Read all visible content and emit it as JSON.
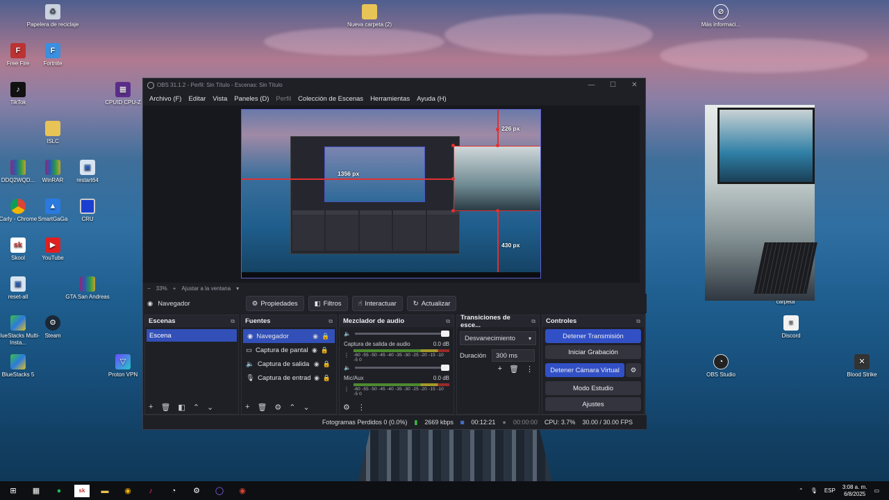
{
  "desktop": {
    "icons": [
      {
        "label": "Papelera de reciclaje",
        "icon": "recycle-bin-icon"
      },
      {
        "label": "Nueva carpeta (2)",
        "icon": "folder-icon"
      },
      {
        "label": "Más informaci...",
        "icon": "info-icon"
      },
      {
        "label": "Free Fire",
        "icon": "free-fire-icon"
      },
      {
        "label": "Fortnite",
        "icon": "fortnite-icon"
      },
      {
        "label": "TikTok",
        "icon": "tiktok-icon"
      },
      {
        "label": "CPUID CPU-Z",
        "icon": "cpu-z-icon"
      },
      {
        "label": "ISLC",
        "icon": "folder-icon"
      },
      {
        "label": "DDQ2WQD...",
        "icon": "winrar-icon"
      },
      {
        "label": "WinRAR",
        "icon": "winrar-icon"
      },
      {
        "label": "restart64",
        "icon": "restart-icon"
      },
      {
        "label": "Carly - Chrome",
        "icon": "chrome-icon"
      },
      {
        "label": "SmartGaGa",
        "icon": "smartgaga-icon"
      },
      {
        "label": "CRU",
        "icon": "monitor-icon"
      },
      {
        "label": "Skool",
        "icon": "skool-icon"
      },
      {
        "label": "YouTube",
        "icon": "youtube-icon"
      },
      {
        "label": "reset-all",
        "icon": "reset-icon"
      },
      {
        "label": "GTA San Andreas",
        "icon": "winrar-icon"
      },
      {
        "label": "BlueStacks Multi-Insta...",
        "icon": "bluestacks-icon"
      },
      {
        "label": "Steam",
        "icon": "steam-icon"
      },
      {
        "label": "BlueStacks 5",
        "icon": "bluestacks-icon"
      },
      {
        "label": "Proton VPN",
        "icon": "proton-vpn-icon"
      },
      {
        "label": "carpeta",
        "icon": "folder-icon"
      },
      {
        "label": "Discord",
        "icon": "file-icon"
      },
      {
        "label": "OBS Studio",
        "icon": "obs-icon"
      },
      {
        "label": "Blood Strike",
        "icon": "blood-strike-icon"
      }
    ]
  },
  "obs": {
    "title": "OBS 31.1.2 - Perfil: Sin Título - Escenas: Sin Título",
    "menu": [
      "Archivo (F)",
      "Editar",
      "Vista",
      "Paneles (D)",
      "Perfil",
      "Colección de Escenas",
      "Herramientas",
      "Ayuda (H)"
    ],
    "preview": {
      "label_top": "226 px",
      "label_left": "1356 px",
      "label_bottom": "430 px"
    },
    "zoom": {
      "minus": "−",
      "value": "33%",
      "plus": "+",
      "fit": "Ajustar a la ventana"
    },
    "source_bar": {
      "name": "Navegador",
      "properties": "Propiedades",
      "filters": "Filtros",
      "interact": "Interactuar",
      "refresh": "Actualizar"
    },
    "scenes": {
      "title": "Escenas",
      "items": [
        "Escena"
      ]
    },
    "sources": {
      "title": "Fuentes",
      "items": [
        "Navegador",
        "Captura de pantalla",
        "Captura de salida de audio",
        "Captura de entrada de audio"
      ]
    },
    "mixer": {
      "title": "Mezclador de audio",
      "channels": [
        {
          "name": "Captura de salida de audio",
          "db": "0.0 dB"
        },
        {
          "name": "Mic/Aux",
          "db": "0.0 dB"
        }
      ],
      "scale": "-60 -55 -50 -45 -40 -35 -30 -25 -20 -15 -10 -5 0"
    },
    "transitions": {
      "title": "Transiciones de esce...",
      "selected": "Desvanecimiento",
      "duration_label": "Duración",
      "duration_value": "300 ms"
    },
    "controls": {
      "title": "Controles",
      "stop_stream": "Detener Transmisión",
      "start_record": "Iniciar Grabación",
      "stop_vcam": "Detener Cámara Virtual",
      "studio_mode": "Modo Estudio",
      "settings": "Ajustes"
    },
    "status": {
      "dropped": "Fotogramas Perdidos 0 (0.0%)",
      "bitrate": "2669 kbps",
      "stream_time": "00:12:21",
      "rec_time": "00:00:00",
      "cpu": "CPU: 3.7%",
      "fps": "30.00 / 30.00 FPS"
    },
    "colors": {
      "accent": "#3250c6",
      "selection": "#3250b8",
      "bounds": "#e23030"
    }
  },
  "taskbar": {
    "lang": "ESP",
    "time": "3:08 a. m.",
    "date": "6/8/2025"
  }
}
